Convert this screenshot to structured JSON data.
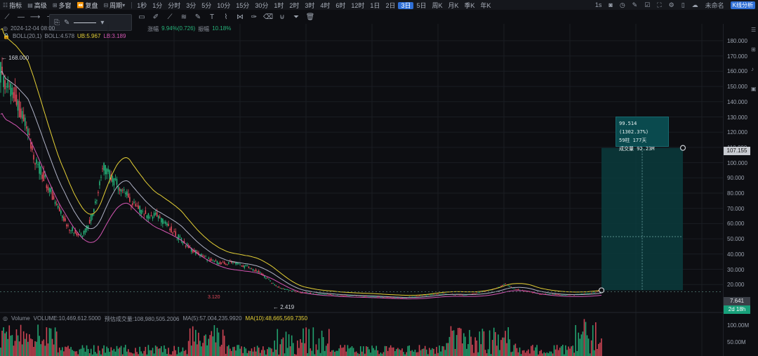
{
  "topbar": {
    "indicators": "指标",
    "advanced": "高级",
    "multi_window": "多窗",
    "replay": "复盘",
    "period": "周期",
    "timeframes": [
      "1秒",
      "1分",
      "分时",
      "3分",
      "5分",
      "10分",
      "15分",
      "30分",
      "1时",
      "2时",
      "3时",
      "4时",
      "6时",
      "12时",
      "1日",
      "2日",
      "3日",
      "5日",
      "周K",
      "月K",
      "季K",
      "年K"
    ],
    "active_timeframe": "3日",
    "right_interval": "1s",
    "unnamed": "未命名",
    "k_analysis": "K线分析"
  },
  "legend": {
    "date": "2024-12-04 08:00",
    "change_label": "涨幅",
    "change_value": "9.94%(0.726)",
    "amplitude_label": "振幅",
    "amplitude_value": "10.18%",
    "boll_name": "BOLL(20,1)",
    "boll_mid": "BOLL:4.578",
    "boll_ub": "UB:5.967",
    "boll_lb": "LB:3.189"
  },
  "volume_legend": {
    "name": "Volume",
    "volume": "VOLUME:10,469,612.5000",
    "predicted": "预估成交量:108,980,505.2006",
    "ma5": "MA(5):57,004,235.9920",
    "ma10": "MA(10):48,665,569.7350"
  },
  "chart_labels": {
    "high": "← 168.000",
    "low": "← 2.419",
    "red_mark": "3.120"
  },
  "axis": {
    "ticks": [
      "180.000",
      "170.000",
      "160.000",
      "150.000",
      "140.000",
      "130.000",
      "120.000",
      "110.000",
      "100.000",
      "90.000",
      "80.000",
      "70.000",
      "60.000",
      "50.000",
      "40.000",
      "30.000",
      "20.000"
    ],
    "vol_ticks": [
      "100.00M",
      "50.00M"
    ],
    "range_tag": "107.155",
    "current_price": "7.641",
    "countdown": "2d 18h"
  },
  "tooltip": {
    "line1": "99.514 (1302.37%)",
    "line2": "59柱 177天",
    "line3": "成交量 92.23M"
  },
  "colors": {
    "up": "#26b37a",
    "down": "#e04a5b",
    "boll_mid": "#b0b3c7",
    "boll_ub": "#e5d035",
    "boll_lb": "#d456b3",
    "range_fill": "#0b3b3d",
    "accent": "#2f6fd6"
  },
  "chart_data": {
    "type": "candlestick",
    "y_range": [
      0,
      185
    ],
    "series": [
      {
        "name": "price",
        "values": [
          160,
          150,
          145,
          130,
          118,
          100,
          90,
          80,
          68,
          60,
          52,
          48,
          46,
          55,
          70,
          95,
          88,
          82,
          78,
          70,
          65,
          62,
          58,
          60,
          55,
          50,
          45,
          40,
          36,
          33,
          30,
          28,
          27,
          26,
          28,
          25,
          24,
          22,
          20,
          16,
          12,
          9,
          8,
          7,
          6,
          6,
          5,
          5,
          5,
          4,
          4,
          4,
          4,
          3.5,
          3.2,
          3,
          3,
          2.8,
          2.5,
          2.42,
          3,
          3.5,
          4,
          4.5,
          5,
          5,
          4.8,
          4.5,
          4.2,
          5,
          6,
          7,
          8,
          10,
          12,
          9,
          8,
          7,
          6,
          5,
          5,
          4.8,
          4.5,
          4.5,
          4.6,
          5,
          5.5,
          6,
          7.641
        ]
      }
    ],
    "range_measure": {
      "start": 7.641,
      "end": 107.155,
      "change": "99.514 (1302.37%)",
      "bars": 59,
      "days": 177,
      "volume": "92.23M"
    }
  }
}
